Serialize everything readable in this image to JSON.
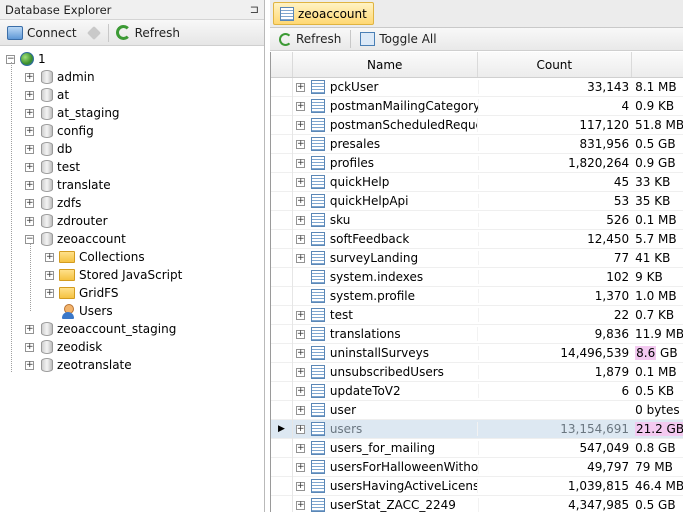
{
  "left_panel": {
    "title": "Database Explorer",
    "pin_glyph": "⊐",
    "toolbar": {
      "connect_label": "Connect",
      "refresh_label": "Refresh"
    },
    "tree": {
      "root": {
        "label": "1",
        "icon": "server-globe-icon"
      },
      "databases": [
        {
          "label": "admin"
        },
        {
          "label": "at"
        },
        {
          "label": "at_staging"
        },
        {
          "label": "config"
        },
        {
          "label": "db"
        },
        {
          "label": "test"
        },
        {
          "label": "translate"
        },
        {
          "label": "zdfs"
        },
        {
          "label": "zdrouter"
        },
        {
          "label": "zeoaccount",
          "expanded": true
        },
        {
          "label": "zeoaccount_staging"
        },
        {
          "label": "zeodisk"
        },
        {
          "label": "zeotranslate"
        }
      ],
      "zeoaccount_children": [
        {
          "label": "Collections",
          "icon": "folder-icon",
          "expandable": true
        },
        {
          "label": "Stored JavaScript",
          "icon": "folder-icon",
          "expandable": true
        },
        {
          "label": "GridFS",
          "icon": "folder-icon",
          "expandable": true
        },
        {
          "label": "Users",
          "icon": "user-icon",
          "expandable": false
        }
      ]
    }
  },
  "right_panel": {
    "tab_label": "zeoaccount",
    "toolbar": {
      "refresh_label": "Refresh",
      "toggle_all_label": "Toggle All"
    },
    "columns": {
      "name": "Name",
      "count": "Count"
    },
    "rows": [
      {
        "name": "pckUser",
        "count": "33,143",
        "size": "8.1 MB",
        "expandable": true
      },
      {
        "name": "postmanMailingCategory",
        "count": "4",
        "size": "0.9 KB",
        "expandable": true
      },
      {
        "name": "postmanScheduledReque...",
        "count": "117,120",
        "size": "51.8 MB",
        "expandable": true
      },
      {
        "name": "presales",
        "count": "831,956",
        "size": "0.5 GB",
        "expandable": true
      },
      {
        "name": "profiles",
        "count": "1,820,264",
        "size": "0.9 GB",
        "expandable": true
      },
      {
        "name": "quickHelp",
        "count": "45",
        "size": "33 KB",
        "expandable": true
      },
      {
        "name": "quickHelpApi",
        "count": "53",
        "size": "35 KB",
        "expandable": true
      },
      {
        "name": "sku",
        "count": "526",
        "size": "0.1 MB",
        "expandable": true
      },
      {
        "name": "softFeedback",
        "count": "12,450",
        "size": "5.7 MB",
        "expandable": true
      },
      {
        "name": "surveyLanding",
        "count": "77",
        "size": "41 KB",
        "expandable": true
      },
      {
        "name": "system.indexes",
        "count": "102",
        "size": "9 KB",
        "expandable": false
      },
      {
        "name": "system.profile",
        "count": "1,370",
        "size": "1.0 MB",
        "expandable": false
      },
      {
        "name": "test",
        "count": "22",
        "size": "0.7 KB",
        "expandable": true
      },
      {
        "name": "translations",
        "count": "9,836",
        "size": "11.9 MB",
        "expandable": true
      },
      {
        "name": "uninstallSurveys",
        "count": "14,496,539",
        "size_highlight": "8.6",
        "size_unit": " GB",
        "expandable": true
      },
      {
        "name": "unsubscribedUsers",
        "count": "1,879",
        "size": "0.1 MB",
        "expandable": true
      },
      {
        "name": "updateToV2",
        "count": "6",
        "size": "0.5 KB",
        "expandable": true
      },
      {
        "name": "user",
        "count": "",
        "size": "0 bytes",
        "expandable": true
      },
      {
        "name": "users",
        "count": "13,154,691",
        "size_highlight": "21.2 GB",
        "size_unit": "",
        "expandable": true,
        "selected": true
      },
      {
        "name": "users_for_mailing",
        "count": "547,049",
        "size": "0.8 GB",
        "expandable": true
      },
      {
        "name": "usersForHalloweenWitho...",
        "count": "49,797",
        "size": "79 MB",
        "expandable": true
      },
      {
        "name": "usersHavingActiveLicenses",
        "count": "1,039,815",
        "size": "46.4 MB",
        "expandable": true
      },
      {
        "name": "userStat_ZACC_2249",
        "count": "4,347,985",
        "size": "0.5 GB",
        "expandable": true
      }
    ],
    "row_indicator_glyph": "▶"
  },
  "colors": {
    "highlight": "#f3c9f0",
    "selected_row": "#dde8f2",
    "tab_active": "#ffd873"
  }
}
